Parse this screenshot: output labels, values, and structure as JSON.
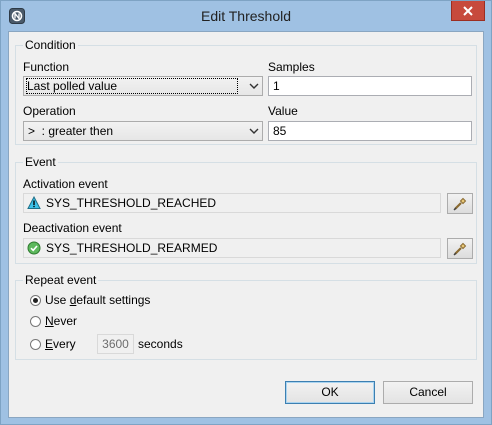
{
  "window": {
    "title": "Edit Threshold",
    "app_icon": "netxms-icon",
    "close_icon": "close-icon"
  },
  "condition": {
    "group_title": "Condition",
    "function_label": "Function",
    "function_value": "Last polled value",
    "samples_label": "Samples",
    "samples_value": "1",
    "operation_label": "Operation",
    "operation_value": ">  : greater then",
    "value_label": "Value",
    "value_value": "85"
  },
  "event": {
    "group_title": "Event",
    "activation_label": "Activation event",
    "activation_value": "SYS_THRESHOLD_REACHED",
    "activation_icon": "warning-icon",
    "deactivation_label": "Deactivation event",
    "deactivation_value": "SYS_THRESHOLD_REARMED",
    "deactivation_icon": "check-circle-icon",
    "picker_icon": "pick-event-icon"
  },
  "repeat": {
    "group_title": "Repeat event",
    "option_default_pre": "Use ",
    "option_default_u": "d",
    "option_default_post": "efault settings",
    "option_never_u": "N",
    "option_never_post": "ever",
    "option_every_u": "E",
    "option_every_post": "very",
    "every_value": "3600",
    "seconds_label": "seconds",
    "selected": "default"
  },
  "buttons": {
    "ok": "OK",
    "cancel": "Cancel"
  }
}
